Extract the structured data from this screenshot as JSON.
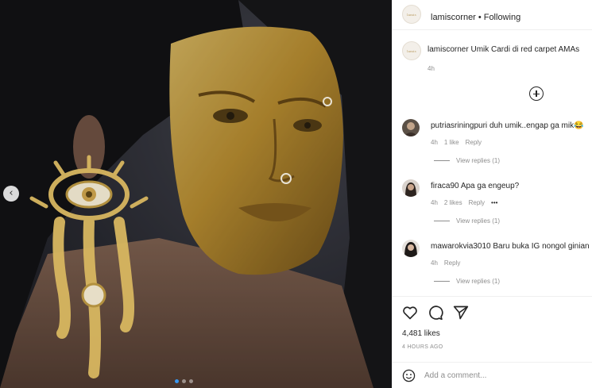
{
  "post": {
    "author": "lamiscorner",
    "follow_state": "Following",
    "separator": "•",
    "avatar_text": "lamis",
    "caption": "Umik Cardi di red carpet AMAs",
    "caption_time": "4h"
  },
  "photo": {
    "prev_arrow": "‹",
    "carousel_position": 1,
    "carousel_count": 3
  },
  "comments": [
    {
      "user": "putriasriningpuri",
      "text": "duh umik..engap ga mik",
      "emoji": "😂",
      "time": "4h",
      "likes": "1 like",
      "reply": "Reply",
      "more": "",
      "view_replies": "View replies (1)"
    },
    {
      "user": "firaca90",
      "text": "Apa ga engeup?",
      "emoji": "",
      "time": "4h",
      "likes": "2 likes",
      "reply": "Reply",
      "more": "•••",
      "view_replies": "View replies (1)"
    },
    {
      "user": "mawarokvia3010",
      "text": "Baru buka IG nongol ginian",
      "emoji": "",
      "time": "4h",
      "likes": "",
      "reply": "Reply",
      "more": "",
      "view_replies": "View replies (1)"
    }
  ],
  "actions": {
    "likes": "4,481 likes",
    "ago": "4 HOURS AGO"
  },
  "add_comment": {
    "placeholder": "Add a comment..."
  }
}
